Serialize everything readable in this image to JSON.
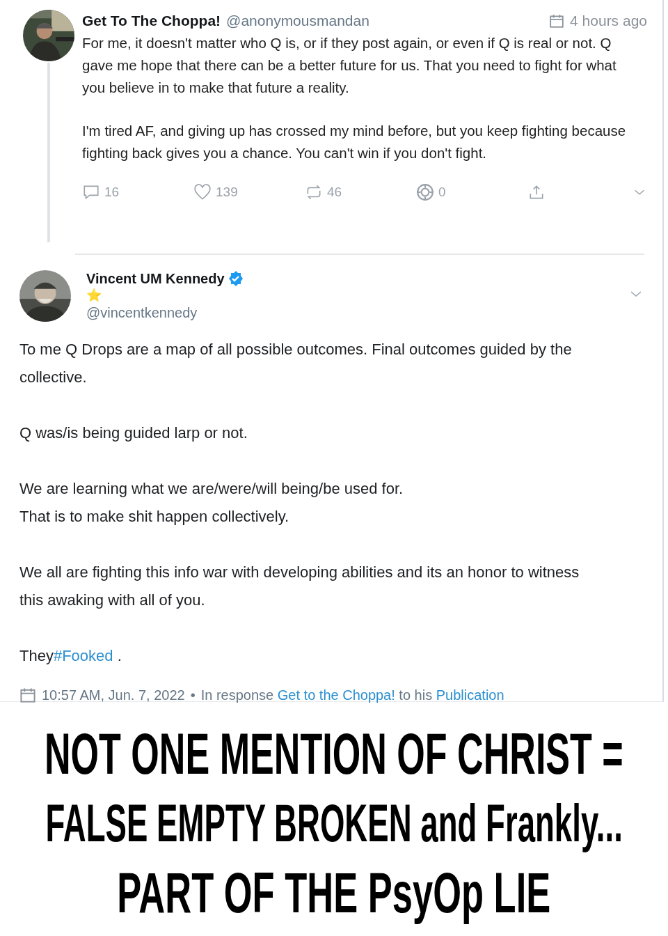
{
  "reply": {
    "name": "Get To The Choppa!",
    "handle": "@anonymousmandan",
    "time": "4 hours ago",
    "paragraphs": [
      "For me, it doesn't matter who Q is, or if they post again, or even if Q is real or not. Q gave me hope that there can be a better future for us. That you need to fight for what you believe in to make that future a reality.",
      "I'm tired AF, and giving up has crossed my mind before, but you keep fighting because fighting back gives you a chance. You can't win if you don't fight."
    ],
    "stats": [
      {
        "kind": "comment",
        "count": "16"
      },
      {
        "kind": "like",
        "count": "139"
      },
      {
        "kind": "repost",
        "count": "46"
      },
      {
        "kind": "target",
        "count": "0"
      },
      {
        "kind": "share"
      },
      {
        "kind": "more"
      }
    ]
  },
  "post": {
    "name": "Vincent UM Kennedy",
    "verified": true,
    "emoji": "⭐",
    "handle": "@vincentkennedy",
    "paragraphs": [
      [
        [
          {
            "kind": "text",
            "text": "To me Q Drops are a map of all possible outcomes. Final outcomes guided by the collective."
          }
        ]
      ],
      [
        [
          {
            "kind": "text",
            "text": "Q was/is being guided larp or not."
          }
        ]
      ],
      [
        [
          {
            "kind": "text",
            "text": "We are learning what we are/were/will being/be used for."
          }
        ],
        [
          {
            "kind": "text",
            "text": "That is to make shit happen collectively."
          }
        ]
      ],
      [
        [
          {
            "kind": "text",
            "text": "We all are fighting this info war with developing abilities and its an honor to witness this awaking with all of you."
          }
        ]
      ],
      [
        [
          {
            "kind": "text",
            "text": "They"
          },
          {
            "kind": "hashtag",
            "text": "#Fooked"
          },
          {
            "kind": "text",
            "text": " ."
          }
        ]
      ]
    ],
    "footer": {
      "date": "10:57 AM, Jun. 7, 2022",
      "separator": "•",
      "parts": [
        {
          "kind": "text",
          "text": "In response "
        },
        {
          "kind": "link",
          "text": "Get to the Choppa!"
        },
        {
          "kind": "text",
          "text": " to his "
        },
        {
          "kind": "link",
          "text": "Publication"
        }
      ]
    }
  },
  "caption": [
    "NOT ONE MENTION OF CHRIST =",
    "FALSE EMPTY BROKEN and Frankly...",
    "PART OF THE PsyOp LIE"
  ]
}
